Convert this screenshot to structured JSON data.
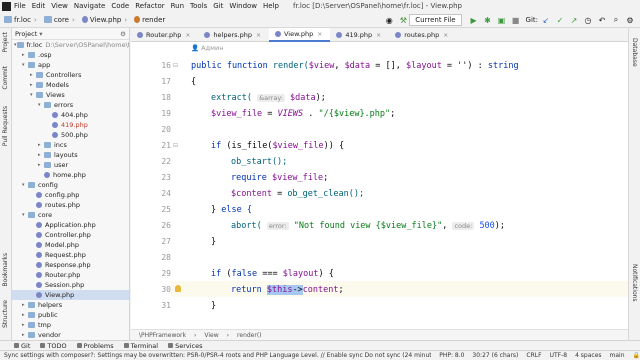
{
  "menubar": {
    "items": [
      "File",
      "Edit",
      "View",
      "Navigate",
      "Code",
      "Refactor",
      "Run",
      "Tools",
      "Git",
      "Window",
      "Help"
    ],
    "title": "fr.loc [D:\\Server\\OSPanel\\home\\fr.loc] - View.php"
  },
  "breadcrumb": [
    "fr.loc",
    "core",
    "View.php",
    "render"
  ],
  "toolbar": {
    "run_config": "Current File",
    "git_label": "Git:"
  },
  "left_strip": [
    "Project",
    "Commit",
    "Pull Requests",
    "Bookmarks",
    "Structure"
  ],
  "right_strip": [
    "Database",
    "Notifications"
  ],
  "project": {
    "title": "Project",
    "tree": [
      {
        "label": "fr.loc",
        "path": "D:\\Server\\OSPanel\\home\\fr.loc",
        "type": "folder",
        "depth": 0,
        "open": true
      },
      {
        "label": ".osp",
        "type": "folder",
        "depth": 1,
        "open": false
      },
      {
        "label": "app",
        "type": "folder",
        "depth": 1,
        "open": true
      },
      {
        "label": "Controllers",
        "type": "folder",
        "depth": 2,
        "open": false
      },
      {
        "label": "Models",
        "type": "folder",
        "depth": 2,
        "open": false
      },
      {
        "label": "Views",
        "type": "folder",
        "depth": 2,
        "open": true
      },
      {
        "label": "errors",
        "type": "folder",
        "depth": 3,
        "open": true
      },
      {
        "label": "404.php",
        "type": "php",
        "depth": 4
      },
      {
        "label": "419.php",
        "type": "php",
        "depth": 4,
        "color": "#c0392b"
      },
      {
        "label": "500.php",
        "type": "php",
        "depth": 4
      },
      {
        "label": "incs",
        "type": "folder",
        "depth": 3,
        "open": false
      },
      {
        "label": "layouts",
        "type": "folder",
        "depth": 3,
        "open": false
      },
      {
        "label": "user",
        "type": "folder",
        "depth": 3,
        "open": false
      },
      {
        "label": "home.php",
        "type": "php",
        "depth": 3
      },
      {
        "label": "config",
        "type": "folder",
        "depth": 1,
        "open": true
      },
      {
        "label": "config.php",
        "type": "php",
        "depth": 2
      },
      {
        "label": "routes.php",
        "type": "php",
        "depth": 2
      },
      {
        "label": "core",
        "type": "folder",
        "depth": 1,
        "open": true
      },
      {
        "label": "Application.php",
        "type": "php",
        "depth": 2
      },
      {
        "label": "Controller.php",
        "type": "php",
        "depth": 2
      },
      {
        "label": "Model.php",
        "type": "php",
        "depth": 2
      },
      {
        "label": "Request.php",
        "type": "php",
        "depth": 2
      },
      {
        "label": "Response.php",
        "type": "php",
        "depth": 2
      },
      {
        "label": "Router.php",
        "type": "php",
        "depth": 2
      },
      {
        "label": "Session.php",
        "type": "php",
        "depth": 2
      },
      {
        "label": "View.php",
        "type": "php",
        "depth": 2,
        "selected": true
      },
      {
        "label": "helpers",
        "type": "folder",
        "depth": 1,
        "open": false
      },
      {
        "label": "public",
        "type": "folder",
        "depth": 1,
        "open": false
      },
      {
        "label": "tmp",
        "type": "folder",
        "depth": 1,
        "open": false
      },
      {
        "label": "vendor",
        "type": "folder",
        "depth": 1,
        "open": false
      }
    ]
  },
  "tabs": [
    {
      "label": "Router.php",
      "active": false
    },
    {
      "label": "helpers.php",
      "active": false
    },
    {
      "label": "View.php",
      "active": true
    },
    {
      "label": "419.php",
      "active": false
    },
    {
      "label": "routes.php",
      "active": false
    }
  ],
  "editor": {
    "author_hint": "Админ",
    "line_numbers": [
      "16",
      "17",
      "18",
      "19",
      "20",
      "21",
      "22",
      "23",
      "24",
      "25",
      "26",
      "27",
      "28",
      "29",
      "30",
      "31"
    ],
    "hint_array": "&array:",
    "hint_error": "error:",
    "hint_code": "code:",
    "code_500": "500",
    "kw_public_function": "public function",
    "fn_render": " render(",
    "v_view": "$view",
    "v_data": "$data",
    "v_layout": "$layout",
    "sig_rest_a": ", ",
    "sig_rest_b": " = [], ",
    "sig_rest_c": " = '') : ",
    "kw_string": "string",
    "brace_open": "{",
    "fn_extract": "extract(",
    "close_semicolon": ");",
    "v_view_file": "$view_file",
    "assign": " = ",
    "const_views": "VIEWS",
    "concat": " . ",
    "str_view_file": "\"/{$view}.php\"",
    "semicolon": ";",
    "kw_if": "if",
    "fn_is_file": " (is_file(",
    "close_if": ")) {",
    "fn_ob_start": "ob_start();",
    "kw_require": "require",
    "v_content": "$content",
    "fn_ob_get_clean": "ob_get_clean();",
    "brace_close": "}",
    "kw_else": " else {",
    "fn_abort": "abort(",
    "str_not_found": "\"Not found view {$view_file}\"",
    "kw_false": "false",
    "op_identical": " === ",
    "kw_return": "return",
    "v_this": "$this",
    "arrow": "->",
    "prop_content": "content",
    "paren_open": " (",
    "paren_close_brace": ") {"
  },
  "editor_breadcrumb": [
    "\\PHPFramework",
    "View",
    "render()"
  ],
  "bottom_tools": [
    "Git",
    "TODO",
    "Problems",
    "Terminal",
    "Services"
  ],
  "status": {
    "message": "Sync settings with composer?: Settings may be overwritten: PSR-0/PSR-4 roots and PHP Language Level. // Enable sync  Do not sync (24 minutes ago)",
    "php": "PHP: 8.0",
    "position": "30:27 (6 chars)",
    "line_sep": "CRLF",
    "encoding": "UTF-8",
    "indent": "4 spaces",
    "branch": "main"
  }
}
